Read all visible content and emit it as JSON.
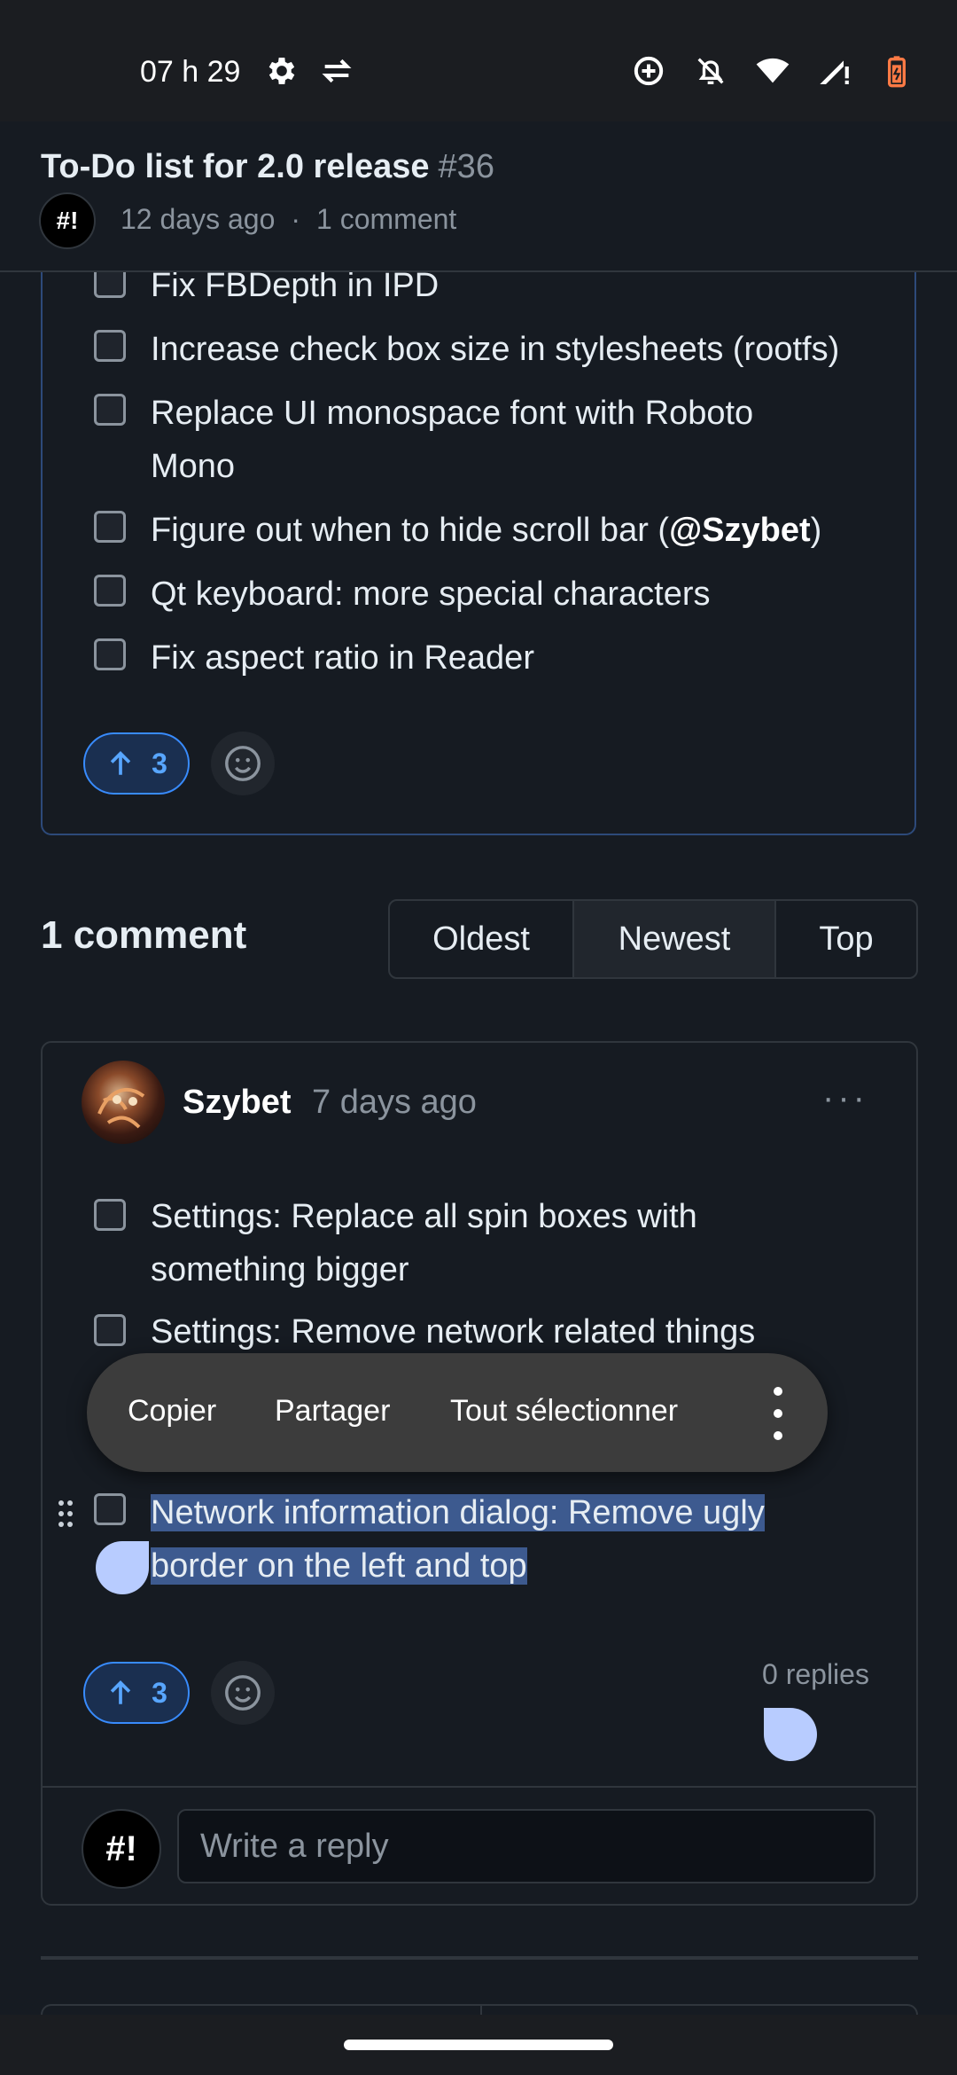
{
  "status_bar": {
    "time": "07 h 29",
    "icons": [
      "gear-icon",
      "data-transfer-icon",
      "data-saver-icon",
      "notifications-off-icon",
      "wifi-icon",
      "signal-icon",
      "battery-icon"
    ]
  },
  "header": {
    "title": "To-Do list for 2.0 release",
    "number": "#36",
    "avatar_text": "#!",
    "age": "12 days ago",
    "separator": "·",
    "comment_count": "1 comment"
  },
  "issue": {
    "tasks": [
      {
        "text": "Fix FBDepth in IPD"
      },
      {
        "text": "Increase check box size in stylesheets (rootfs)"
      },
      {
        "text_line1": "Replace UI monospace font with Roboto",
        "text_line2": "Mono"
      },
      {
        "pre": "Figure out when to hide scroll bar (",
        "mention": "@Szybet",
        "post": ")"
      },
      {
        "text": "Qt keyboard: more special characters"
      },
      {
        "text": "Fix aspect ratio in Reader"
      }
    ],
    "upvotes": "3"
  },
  "comments_section": {
    "title": "1 comment",
    "sort_options": [
      {
        "label": "Oldest",
        "selected": false
      },
      {
        "label": "Newest",
        "selected": true
      },
      {
        "label": "Top",
        "selected": false
      }
    ]
  },
  "comment": {
    "author": "Szybet",
    "time": "7 days ago",
    "more": "···",
    "tasks": [
      {
        "line1": "Settings: Replace all spin boxes with",
        "line2": "something bigger"
      },
      {
        "line1": "Settings: Remove network related things"
      },
      {
        "line1": "Network information dialog: Remove ugly",
        "line2": "border on the left and top"
      }
    ],
    "upvotes": "3",
    "replies": "0 replies"
  },
  "context_menu": {
    "copy": "Copier",
    "share": "Partager",
    "select_all": "Tout sélectionner"
  },
  "reply": {
    "avatar_text": "#!",
    "placeholder": "Write a reply"
  },
  "colors": {
    "background": "#161b22",
    "accent": "#388bfd",
    "selection": "#3d5a8f"
  }
}
